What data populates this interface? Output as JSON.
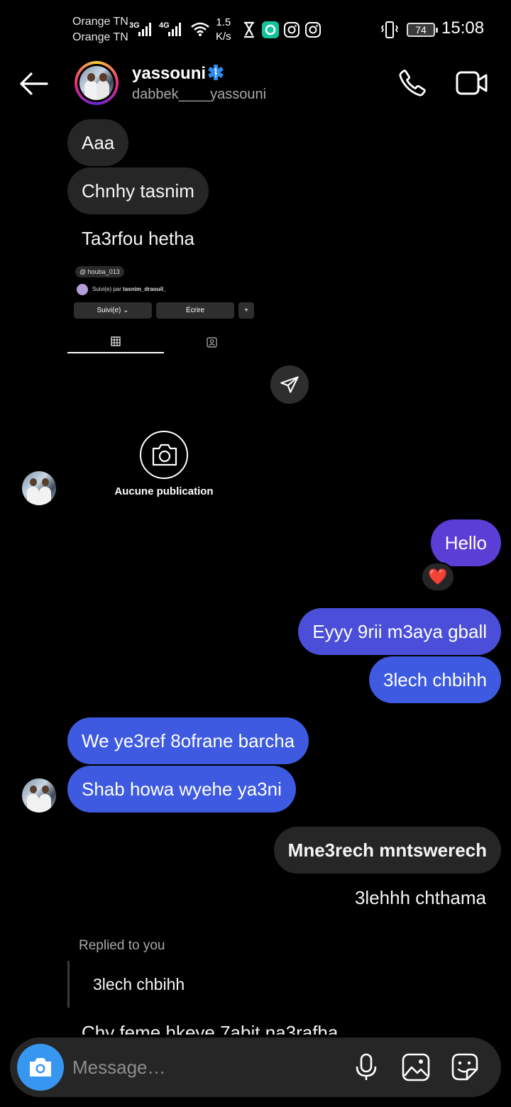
{
  "status_bar": {
    "carrier_1": "Orange TN",
    "carrier_2": "Orange TN",
    "net_1": "3G",
    "net_2": "4G",
    "speed_value": "1.5",
    "speed_unit": "K/s",
    "battery": "74",
    "time": "15:08"
  },
  "header": {
    "name": "yassouni",
    "handle": "dabbek____yassouni"
  },
  "messages": {
    "m1": "Aaa",
    "m2": "Chnhy tasnim",
    "m3": "Ta3rfou hetha",
    "shared_post": {
      "tag": "houba_013",
      "followed_prefix": "Suivi(e) par",
      "followed_by": "tasnim_draouil_",
      "follow_btn": "Suivi(e)",
      "write_btn": "Écrire",
      "no_posts": "Aucune publication"
    },
    "m4": "Hello",
    "m4_reaction": "❤️",
    "m5": "Eyyy 9rii m3aya gball",
    "m6": "3lech chbihh",
    "m7": "We ye3ref 8ofrane barcha",
    "m8": "Shab howa wyehe ya3ni",
    "m9": "Mne3rech mntswerech",
    "m10": "3lehhh chthama",
    "reply_label": "Replied to you",
    "reply_quote": "3lech chbihh",
    "m11": "Chy feme hkeye 7abit na3rafha"
  },
  "composer": {
    "placeholder": "Message…"
  },
  "colors": {
    "purple_bubble": "#5b3ed6",
    "blue_bubble": "#3d5ae0",
    "gray_bubble": "#262626",
    "camera_button": "#3797f0"
  }
}
